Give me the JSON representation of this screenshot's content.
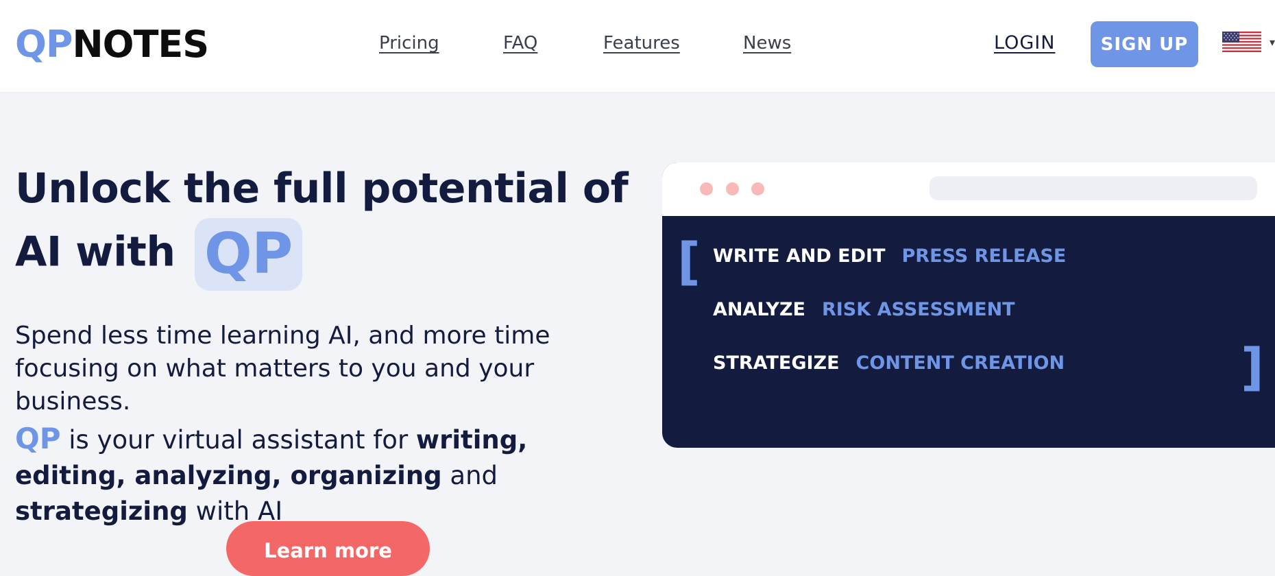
{
  "header": {
    "logo_prefix": "QP",
    "logo_suffix": "NOTES",
    "nav": [
      "Pricing",
      "FAQ",
      "Features",
      "News"
    ],
    "login_label": "LOGIN",
    "signup_label": "SIGN UP",
    "language_flag": "us-flag-icon",
    "dropdown_icon": "caret-down-icon"
  },
  "hero": {
    "headline_text": "Unlock the full potential of AI with",
    "headline_highlight": "QP",
    "subtitle": "Spend less time learning AI, and more time focusing on what matters to you and your business.",
    "tagline": {
      "brand": "QP",
      "text_1": " is your virtual assistant for ",
      "bold_1": "writing, editing, analyzing, organizing",
      "text_2": " and ",
      "bold_2": "strategizing",
      "text_3": " with AI"
    },
    "cta_label": "Learn more"
  },
  "demo_window": {
    "open_bracket": "[",
    "close_bracket": "]",
    "rows": [
      {
        "verb": "WRITE AND EDIT",
        "object": "PRESS RELEASE"
      },
      {
        "verb": "ANALYZE",
        "object": "RISK ASSESSMENT"
      },
      {
        "verb": "STRATEGIZE",
        "object": "CONTENT CREATION"
      }
    ]
  },
  "colors": {
    "accent_blue": "#6f95e6",
    "navy": "#131c3f",
    "cta_red": "#f46767",
    "page_bg": "#f3f4f8"
  }
}
